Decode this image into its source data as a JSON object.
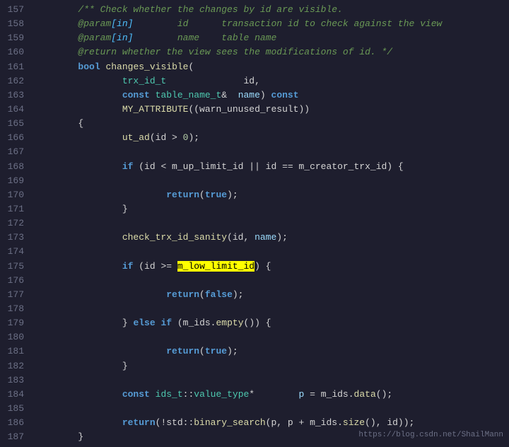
{
  "lines": [
    {
      "num": "157",
      "tokens": [
        {
          "t": "        ",
          "c": "plain"
        },
        {
          "t": "/** Check whether the changes by id are visible.",
          "c": "comment"
        }
      ]
    },
    {
      "num": "158",
      "tokens": [
        {
          "t": "        ",
          "c": "plain"
        },
        {
          "t": "@param",
          "c": "comment"
        },
        {
          "t": "[in]",
          "c": "param-tag"
        },
        {
          "t": "        id      transaction id to check against the view",
          "c": "comment"
        }
      ]
    },
    {
      "num": "159",
      "tokens": [
        {
          "t": "        ",
          "c": "plain"
        },
        {
          "t": "@param",
          "c": "comment"
        },
        {
          "t": "[in]",
          "c": "param-tag"
        },
        {
          "t": "        name    table name",
          "c": "comment"
        }
      ]
    },
    {
      "num": "160",
      "tokens": [
        {
          "t": "        ",
          "c": "plain"
        },
        {
          "t": "@return whether the view sees the modifications of id. */",
          "c": "comment"
        }
      ]
    },
    {
      "num": "161",
      "tokens": [
        {
          "t": "        ",
          "c": "plain"
        },
        {
          "t": "bool",
          "c": "keyword"
        },
        {
          "t": " ",
          "c": "plain"
        },
        {
          "t": "changes_visible",
          "c": "func-name"
        },
        {
          "t": "(",
          "c": "plain"
        }
      ]
    },
    {
      "num": "162",
      "tokens": [
        {
          "t": "                ",
          "c": "plain"
        },
        {
          "t": "trx_id_t",
          "c": "type"
        },
        {
          "t": "              id,",
          "c": "plain"
        }
      ]
    },
    {
      "num": "163",
      "tokens": [
        {
          "t": "                ",
          "c": "plain"
        },
        {
          "t": "const",
          "c": "keyword"
        },
        {
          "t": " ",
          "c": "plain"
        },
        {
          "t": "table_name_t",
          "c": "type"
        },
        {
          "t": "&  ",
          "c": "plain"
        },
        {
          "t": "name",
          "c": "param-name"
        },
        {
          "t": ") ",
          "c": "plain"
        },
        {
          "t": "const",
          "c": "keyword"
        }
      ]
    },
    {
      "num": "164",
      "tokens": [
        {
          "t": "                ",
          "c": "plain"
        },
        {
          "t": "MY_ATTRIBUTE",
          "c": "func-name"
        },
        {
          "t": "((warn_unused_result))",
          "c": "plain"
        }
      ]
    },
    {
      "num": "165",
      "tokens": [
        {
          "t": "        {",
          "c": "plain"
        }
      ]
    },
    {
      "num": "166",
      "tokens": [
        {
          "t": "                ",
          "c": "plain"
        },
        {
          "t": "ut_ad",
          "c": "func-name"
        },
        {
          "t": "(id > ",
          "c": "plain"
        },
        {
          "t": "0",
          "c": "number"
        },
        {
          "t": ");",
          "c": "plain"
        }
      ]
    },
    {
      "num": "167",
      "tokens": [
        {
          "t": "",
          "c": "plain"
        }
      ]
    },
    {
      "num": "168",
      "tokens": [
        {
          "t": "                ",
          "c": "plain"
        },
        {
          "t": "if",
          "c": "keyword"
        },
        {
          "t": " (id < m_up_limit_id || id == m_creator_trx_id) {",
          "c": "plain"
        }
      ]
    },
    {
      "num": "169",
      "tokens": [
        {
          "t": "",
          "c": "plain"
        }
      ]
    },
    {
      "num": "170",
      "tokens": [
        {
          "t": "                        ",
          "c": "plain"
        },
        {
          "t": "return",
          "c": "keyword"
        },
        {
          "t": "(",
          "c": "plain"
        },
        {
          "t": "true",
          "c": "keyword"
        },
        {
          "t": ");",
          "c": "plain"
        }
      ]
    },
    {
      "num": "171",
      "tokens": [
        {
          "t": "                }",
          "c": "plain"
        }
      ]
    },
    {
      "num": "172",
      "tokens": [
        {
          "t": "",
          "c": "plain"
        }
      ]
    },
    {
      "num": "173",
      "tokens": [
        {
          "t": "                ",
          "c": "plain"
        },
        {
          "t": "check_trx_id_sanity",
          "c": "func-name"
        },
        {
          "t": "(id, ",
          "c": "plain"
        },
        {
          "t": "name",
          "c": "param-name"
        },
        {
          "t": ");",
          "c": "plain"
        }
      ]
    },
    {
      "num": "174",
      "tokens": [
        {
          "t": "",
          "c": "plain"
        }
      ]
    },
    {
      "num": "175",
      "tokens": [
        {
          "t": "                ",
          "c": "plain"
        },
        {
          "t": "if",
          "c": "keyword"
        },
        {
          "t": " (id >= ",
          "c": "plain"
        },
        {
          "t": "m_low_limit_id",
          "c": "highlight"
        },
        {
          "t": ") {",
          "c": "plain"
        }
      ]
    },
    {
      "num": "176",
      "tokens": [
        {
          "t": "",
          "c": "plain"
        }
      ]
    },
    {
      "num": "177",
      "tokens": [
        {
          "t": "                        ",
          "c": "plain"
        },
        {
          "t": "return",
          "c": "keyword"
        },
        {
          "t": "(",
          "c": "plain"
        },
        {
          "t": "false",
          "c": "keyword"
        },
        {
          "t": ");",
          "c": "plain"
        }
      ]
    },
    {
      "num": "178",
      "tokens": [
        {
          "t": "",
          "c": "plain"
        }
      ]
    },
    {
      "num": "179",
      "tokens": [
        {
          "t": "                } ",
          "c": "plain"
        },
        {
          "t": "else",
          "c": "keyword"
        },
        {
          "t": " ",
          "c": "plain"
        },
        {
          "t": "if",
          "c": "keyword"
        },
        {
          "t": " (m_ids.",
          "c": "plain"
        },
        {
          "t": "empty",
          "c": "func-name"
        },
        {
          "t": "()) {",
          "c": "plain"
        }
      ]
    },
    {
      "num": "180",
      "tokens": [
        {
          "t": "",
          "c": "plain"
        }
      ]
    },
    {
      "num": "181",
      "tokens": [
        {
          "t": "                        ",
          "c": "plain"
        },
        {
          "t": "return",
          "c": "keyword"
        },
        {
          "t": "(",
          "c": "plain"
        },
        {
          "t": "true",
          "c": "keyword"
        },
        {
          "t": ");",
          "c": "plain"
        }
      ]
    },
    {
      "num": "182",
      "tokens": [
        {
          "t": "                }",
          "c": "plain"
        }
      ]
    },
    {
      "num": "183",
      "tokens": [
        {
          "t": "",
          "c": "plain"
        }
      ]
    },
    {
      "num": "184",
      "tokens": [
        {
          "t": "                ",
          "c": "plain"
        },
        {
          "t": "const",
          "c": "keyword"
        },
        {
          "t": " ",
          "c": "plain"
        },
        {
          "t": "ids_t",
          "c": "type"
        },
        {
          "t": "::",
          "c": "plain"
        },
        {
          "t": "value_type",
          "c": "type"
        },
        {
          "t": "*        ",
          "c": "plain"
        },
        {
          "t": "p",
          "c": "param-name"
        },
        {
          "t": " = m_ids.",
          "c": "plain"
        },
        {
          "t": "data",
          "c": "func-name"
        },
        {
          "t": "();",
          "c": "plain"
        }
      ]
    },
    {
      "num": "185",
      "tokens": [
        {
          "t": "",
          "c": "plain"
        }
      ]
    },
    {
      "num": "186",
      "tokens": [
        {
          "t": "                ",
          "c": "plain"
        },
        {
          "t": "return",
          "c": "keyword"
        },
        {
          "t": "(!std::",
          "c": "plain"
        },
        {
          "t": "binary_search",
          "c": "func-name"
        },
        {
          "t": "(p, p + m_ids.",
          "c": "plain"
        },
        {
          "t": "size",
          "c": "func-name"
        },
        {
          "t": "(), id));",
          "c": "plain"
        }
      ]
    },
    {
      "num": "187",
      "tokens": [
        {
          "t": "        }",
          "c": "plain"
        }
      ]
    }
  ],
  "url": "https://blog.csdn.net/ShailMann"
}
